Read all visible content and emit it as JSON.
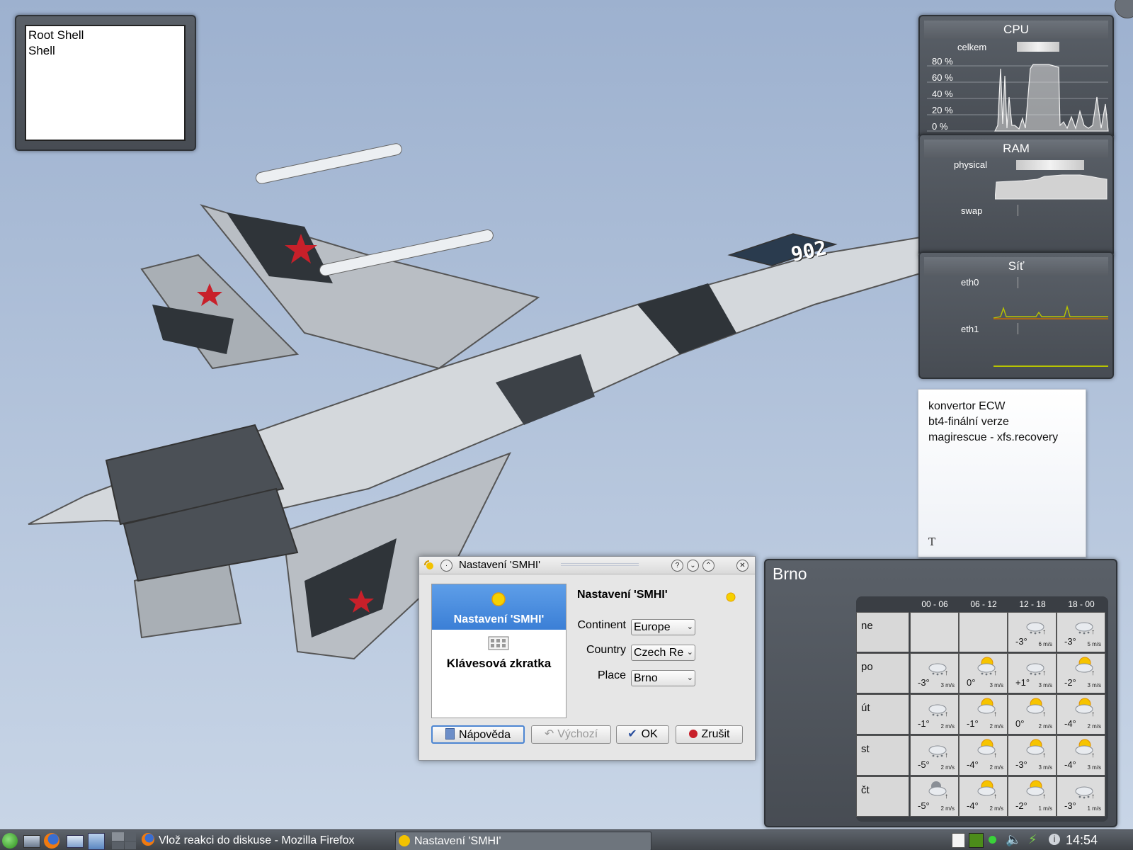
{
  "launcher": {
    "items": [
      "Root Shell",
      "Shell"
    ]
  },
  "cpu": {
    "title": "CPU",
    "label": "celkem",
    "ticks": [
      "80 %",
      "60 %",
      "40 %",
      "20 %",
      "0 %"
    ]
  },
  "ram": {
    "title": "RAM",
    "physical_label": "physical",
    "swap_label": "swap"
  },
  "net": {
    "title": "Síť",
    "if1": "eth0",
    "if2": "eth1"
  },
  "note": {
    "lines": [
      "konvertor ECW",
      "bt4-finální verze",
      "magirescue - xfs.recovery"
    ],
    "glyph": "T"
  },
  "aircraft": {
    "tail": "902"
  },
  "weather": {
    "city": "Brno",
    "headers": [
      "00 - 06",
      "06 - 12",
      "12 - 18",
      "18 - 00"
    ],
    "rows": [
      {
        "day": "ne",
        "cells": [
          null,
          null,
          {
            "temp": "-3°",
            "wind": "6 m/s",
            "icon": "snow-cloud"
          },
          {
            "temp": "-3°",
            "wind": "5 m/s",
            "icon": "snow-cloud"
          }
        ]
      },
      {
        "day": "po",
        "cells": [
          {
            "temp": "-3°",
            "wind": "3 m/s",
            "icon": "snow-cloud"
          },
          {
            "temp": "0°",
            "wind": "3 m/s",
            "icon": "sun-snow"
          },
          {
            "temp": "+1°",
            "wind": "3 m/s",
            "icon": "snow-cloud"
          },
          {
            "temp": "-2°",
            "wind": "3 m/s",
            "icon": "sun-cloud"
          }
        ]
      },
      {
        "day": "út",
        "cells": [
          {
            "temp": "-1°",
            "wind": "2 m/s",
            "icon": "snow-cloud"
          },
          {
            "temp": "-1°",
            "wind": "2 m/s",
            "icon": "sun-cloud"
          },
          {
            "temp": "0°",
            "wind": "2 m/s",
            "icon": "sun-cloud"
          },
          {
            "temp": "-4°",
            "wind": "2 m/s",
            "icon": "sun-cloud"
          }
        ]
      },
      {
        "day": "st",
        "cells": [
          {
            "temp": "-5°",
            "wind": "2 m/s",
            "icon": "snow-cloud"
          },
          {
            "temp": "-4°",
            "wind": "2 m/s",
            "icon": "sun-cloud"
          },
          {
            "temp": "-3°",
            "wind": "3 m/s",
            "icon": "sun-cloud"
          },
          {
            "temp": "-4°",
            "wind": "3 m/s",
            "icon": "sun-cloud"
          }
        ]
      },
      {
        "day": "čt",
        "cells": [
          {
            "temp": "-5°",
            "wind": "2 m/s",
            "icon": "moon-cloud"
          },
          {
            "temp": "-4°",
            "wind": "2 m/s",
            "icon": "sun-cloud"
          },
          {
            "temp": "-2°",
            "wind": "1 m/s",
            "icon": "sun-cloud"
          },
          {
            "temp": "-3°",
            "wind": "1 m/s",
            "icon": "snow-cloud"
          }
        ]
      }
    ]
  },
  "dialog": {
    "title": "Nastavení 'SMHI'",
    "pages": [
      "Nastavení 'SMHI'",
      "Klávesová zkratka"
    ],
    "heading": "Nastavení 'SMHI'",
    "fields": [
      {
        "label": "Continent",
        "value": "Europe"
      },
      {
        "label": "Country",
        "value": "Czech Re"
      },
      {
        "label": "Place",
        "value": "Brno"
      }
    ],
    "buttons": {
      "help": "Nápověda",
      "defaults": "Výchozí",
      "ok": "OK",
      "cancel": "Zrušit"
    }
  },
  "taskbar": {
    "tasks": [
      "Vlož reakci do diskuse - Mozilla Firefox",
      "Nastavení 'SMHI'"
    ],
    "clock": "14:54"
  },
  "colors": {
    "accent": "#3b7fd6",
    "panel": "#4f545b",
    "graph_line": "#b8c400"
  }
}
